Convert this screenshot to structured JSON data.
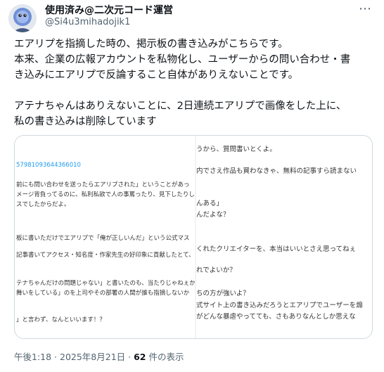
{
  "author": {
    "display_name": "使用済み@二次元コード運営",
    "handle": "@Si4u3mihadojik1"
  },
  "tweet": {
    "paragraphs": [
      "エアリプを指摘した時の、掲示板の書き込みがこちらです。",
      "本来、企業の広報アカウントを私物化し、ユーザーからの問い合わせ・書",
      "き込みにエアリプで反論すること自体がありえないことです。",
      "",
      "アテナちゃんはありえないことに、2日連続エアリプで画像をした上に、",
      "私の書き込みは削除しています"
    ]
  },
  "screenshots": {
    "left_lines": [
      "579810936443660​10",
      "前にも問い合わせを送ったらエアリプされた」ということがあっ",
      "メージ背負ってるのに、私利私欲で人の事罵ったり、見下したりし",
      "スでしたからだよ。",
      "板に書いただけでエアリプで「俺が正しいんだ」という公式マス",
      "記事書いてアクセス・知名度・作家先生の好印象に貢献したとて、",
      "テナちゃんだけの問題じゃない」と書いたのも、当たりじゃねぇか",
      "舞いをしている」のを上司やその部署の人間が誰も指摘しないか",
      "」と言わず、なんといいます！？"
    ],
    "right_lines": [
      "うから、質問書いとくよ。",
      "内でさえ作品も買わなきゃ、無料の記事すら読まない",
      "んある」",
      "んだよな？",
      "くれたクリエイターを、本当はいいとさえ思ってねぇ",
      "れでよいか？",
      "ちの方が強いよ？",
      "式サイト上の書き込みだろうとエアリプでユーザーを煽",
      "がどんな暴虐やってても、さもありなんとしか思えな"
    ]
  },
  "meta": {
    "time": "午後1:18 · 2025年8月21日 · ",
    "views_count": "62",
    "views_label": " 件の表示"
  },
  "icons": {
    "more": "more-options-icon",
    "avatar": "avatar-image"
  }
}
